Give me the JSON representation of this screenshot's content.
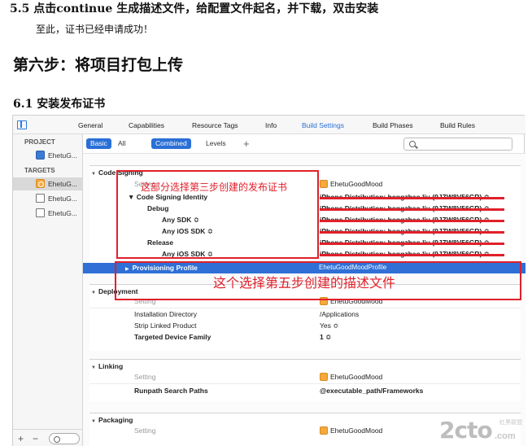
{
  "doc": {
    "step55": "5.5 点击continue 生成描述文件，给配置文件起名，并下载，双击安装",
    "success": "至此，证书已经申请成功！",
    "step6": "第六步：将项目打包上传",
    "step61": "6.1 安装发布证书"
  },
  "tabs": [
    "General",
    "Capabilities",
    "Resource Tags",
    "Info",
    "Build Settings",
    "Build Phases",
    "Build Rules"
  ],
  "active_tab": "Build Settings",
  "sidebar": {
    "project_header": "PROJECT",
    "project_item": "EhetuG...",
    "targets_header": "TARGETS",
    "targets": [
      "EhetuG...",
      "EhetuG...",
      "EhetuG..."
    ]
  },
  "scope": {
    "basic": "Basic",
    "all": "All",
    "combined": "Combined",
    "levels": "Levels",
    "add": "+",
    "search_placeholder": ""
  },
  "code_signing": {
    "title": "Code Signing",
    "setting": "Setting",
    "target_name": "EhetuGoodMood",
    "identity": "Code Signing Identity",
    "debug": "Debug",
    "any_sdk": "Any SDK ≎",
    "any_ios_sdk": "Any iOS SDK ≎",
    "release": "Release",
    "any_ios_sdk_release": "Any iOS SDK ≎",
    "cert_value": "iPhone Distribution: hongzhao liu (9JZW8V56GR) ≎",
    "provisioning": "Provisioning Profile",
    "provisioning_value": "EhetuGoodMoodProfile"
  },
  "deployment": {
    "title": "Deployment",
    "setting": "Setting",
    "target_name": "EhetuGoodMood",
    "rows": [
      {
        "key": "Installation Directory",
        "value": "/Applications",
        "bold": false
      },
      {
        "key": "Strip Linked Product",
        "value": "Yes ≎",
        "bold": false
      },
      {
        "key": "Targeted Device Family",
        "value": "1 ≎",
        "bold": true
      }
    ]
  },
  "linking": {
    "title": "Linking",
    "setting": "Setting",
    "target_name": "EhetuGoodMood",
    "runpath_key": "Runpath Search Paths",
    "runpath_value": "@executable_path/Frameworks"
  },
  "packaging": {
    "title": "Packaging",
    "setting": "Setting",
    "target_name": "EhetuGoodMood"
  },
  "annotations": {
    "cert_note": "这部分选择第三步创建的发布证书",
    "profile_note": "这个选择第五步创建的描述文件",
    "color": "#e0202a"
  },
  "footer": {
    "add": "+",
    "remove": "−"
  },
  "watermark": {
    "main": "2cto",
    "sub": "红黑联盟",
    "domain": ".com"
  }
}
